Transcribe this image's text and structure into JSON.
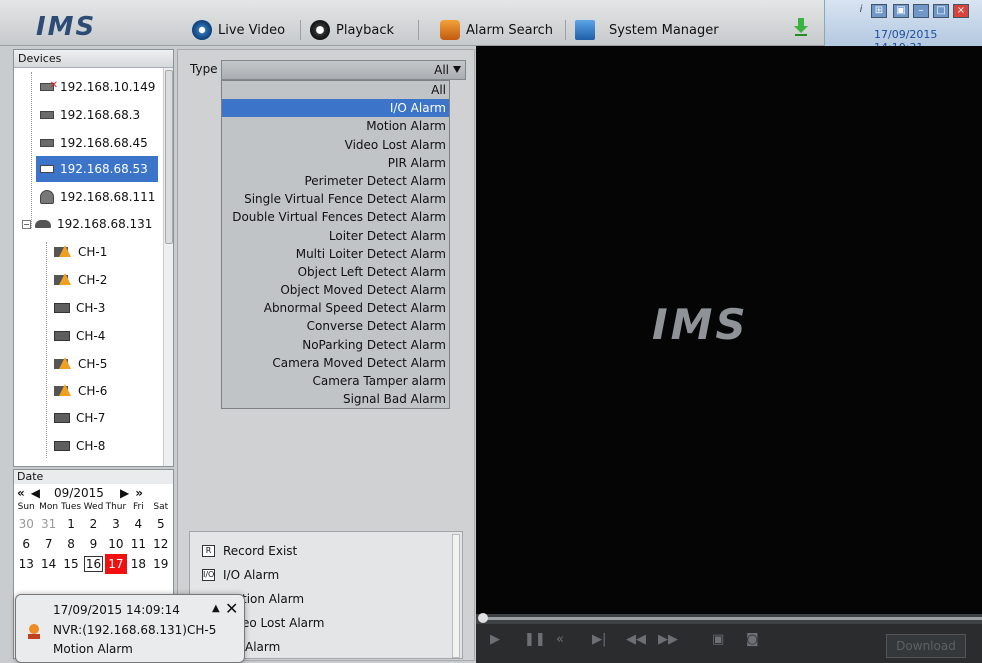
{
  "app": {
    "logo": "IMS",
    "clock": "17/09/2015 14:10:31"
  },
  "tabs": [
    {
      "label": "Live Video"
    },
    {
      "label": "Playback"
    },
    {
      "label": "Alarm Search"
    },
    {
      "label": "System Manager"
    }
  ],
  "devices": {
    "title": "Devices",
    "items": [
      {
        "label": "192.168.10.149",
        "icon": "offline-camera-icon"
      },
      {
        "label": "192.168.68.3",
        "icon": "camera-icon"
      },
      {
        "label": "192.168.68.45",
        "icon": "camera-icon"
      },
      {
        "label": "192.168.68.53",
        "icon": "camera-icon",
        "selected": true
      },
      {
        "label": "192.168.68.111",
        "icon": "dome-camera-icon"
      },
      {
        "label": "192.168.68.131",
        "icon": "nvr-icon"
      },
      {
        "label": "CH-1",
        "icon": "warning-channel-icon"
      },
      {
        "label": "CH-2",
        "icon": "warning-channel-icon"
      },
      {
        "label": "CH-3",
        "icon": "channel-icon"
      },
      {
        "label": "CH-4",
        "icon": "channel-icon"
      },
      {
        "label": "CH-5",
        "icon": "warning-channel-icon"
      },
      {
        "label": "CH-6",
        "icon": "warning-channel-icon"
      },
      {
        "label": "CH-7",
        "icon": "channel-icon"
      },
      {
        "label": "CH-8",
        "icon": "channel-icon"
      }
    ]
  },
  "date": {
    "title": "Date",
    "month": "09/2015",
    "dows": [
      "Sun",
      "Mon",
      "Tues",
      "Wed",
      "Thur",
      "Fri",
      "Sat"
    ],
    "days": [
      "30",
      "31",
      "1",
      "2",
      "3",
      "4",
      "5",
      "6",
      "7",
      "8",
      "9",
      "10",
      "11",
      "12",
      "13",
      "14",
      "15",
      "16",
      "17",
      "18",
      "19"
    ]
  },
  "filter": {
    "type_label": "Type",
    "type_value": "All",
    "options": [
      "All",
      "I/O Alarm",
      "Motion Alarm",
      "Video Lost Alarm",
      "PIR Alarm",
      "Perimeter Detect Alarm",
      "Single Virtual Fence Detect Alarm",
      "Double Virtual Fences Detect Alarm",
      "Loiter Detect Alarm",
      "Multi Loiter Detect Alarm",
      "Object Left Detect Alarm",
      "Object Moved Detect Alarm",
      "Abnormal Speed Detect Alarm",
      "Converse Detect Alarm",
      "NoParking Detect Alarm",
      "Camera Moved Detect Alarm",
      "Camera Tamper alarm",
      "Signal Bad Alarm"
    ],
    "highlighted": "I/O Alarm"
  },
  "legend": [
    {
      "box": "R",
      "label": "Record Exist"
    },
    {
      "box": "I/O",
      "label": "I/O Alarm"
    },
    {
      "box": "",
      "label": "tion Alarm"
    },
    {
      "box": "",
      "label": "eo Lost Alarm"
    },
    {
      "box": "",
      "label": "Alarm"
    }
  ],
  "player": {
    "logo": "IMS",
    "download_label": "Download"
  },
  "popup": {
    "time": "17/09/2015 14:09:14",
    "device": "NVR:(192.168.68.131)CH-5",
    "type": "Motion Alarm"
  }
}
